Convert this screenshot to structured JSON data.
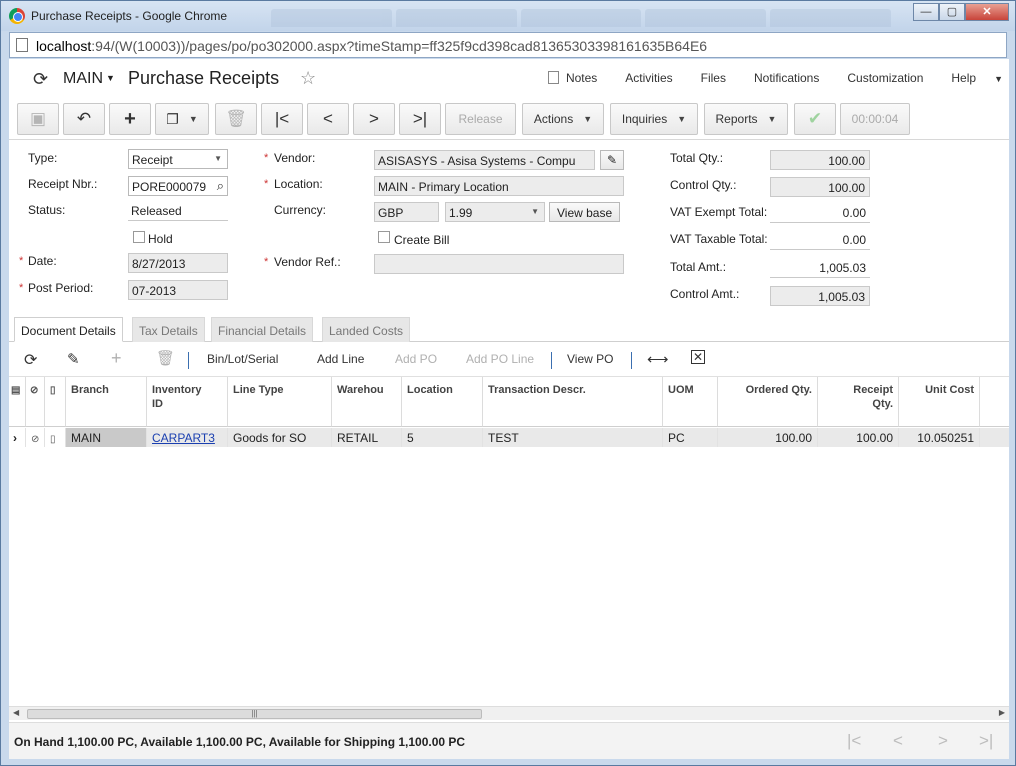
{
  "window": {
    "title": "Purchase Receipts - Google Chrome",
    "minimize": "—",
    "maximize": "▢",
    "close": "✕",
    "url_host": "localhost",
    "url_rest": ":94/(W(10003))/pages/po/po302000.aspx?timeStamp=ff325f9cd398cad81365303398161635B64E6"
  },
  "header": {
    "company": "MAIN",
    "title": "Purchase Receipts",
    "links": [
      "Notes",
      "Activities",
      "Files",
      "Notifications",
      "Customization",
      "Help"
    ]
  },
  "toolbar": {
    "release": "Release",
    "actions": "Actions",
    "inquiries": "Inquiries",
    "reports": "Reports",
    "timer": "00:00:04"
  },
  "form": {
    "type_label": "Type:",
    "type_value": "Receipt",
    "receipt_nbr_label": "Receipt Nbr.:",
    "receipt_nbr_value": "PORE000079",
    "status_label": "Status:",
    "status_value": "Released",
    "hold_label": "Hold",
    "date_label": "Date:",
    "date_value": "8/27/2013",
    "post_period_label": "Post Period:",
    "post_period_value": "07-2013",
    "vendor_label": "Vendor:",
    "vendor_value": "ASISASYS - Asisa Systems - Compu",
    "location_label": "Location:",
    "location_value": "MAIN - Primary Location",
    "currency_label": "Currency:",
    "currency_code": "GBP",
    "currency_rate": "1.99",
    "view_base": "View base",
    "create_bill_label": "Create Bill",
    "vendor_ref_label": "Vendor Ref.:",
    "vendor_ref_value": "",
    "total_qty_label": "Total Qty.:",
    "total_qty_value": "100.00",
    "control_qty_label": "Control Qty.:",
    "control_qty_value": "100.00",
    "vat_exempt_label": "VAT Exempt Total:",
    "vat_exempt_value": "0.00",
    "vat_taxable_label": "VAT Taxable Total:",
    "vat_taxable_value": "0.00",
    "total_amt_label": "Total Amt.:",
    "total_amt_value": "1,005.03",
    "control_amt_label": "Control Amt.:",
    "control_amt_value": "1,005.03"
  },
  "tabs": [
    "Document Details",
    "Tax Details",
    "Financial Details",
    "Landed Costs"
  ],
  "grid_toolbar": {
    "bin_lot_serial": "Bin/Lot/Serial",
    "add_line": "Add Line",
    "add_po": "Add PO",
    "add_po_line": "Add PO Line",
    "view_po": "View PO"
  },
  "grid": {
    "columns": {
      "branch": "Branch",
      "inventory_id_1": "Inventory",
      "inventory_id_2": "ID",
      "line_type": "Line Type",
      "warehouse": "Warehou",
      "location": "Location",
      "transaction_descr": "Transaction Descr.",
      "uom": "UOM",
      "ordered_qty": "Ordered Qty.",
      "receipt_qty_1": "Receipt",
      "receipt_qty_2": "Qty.",
      "unit_cost": "Unit Cost"
    },
    "row": {
      "branch": "MAIN",
      "inventory_id": "CARPART3",
      "line_type": "Goods for SO",
      "warehouse": "RETAIL",
      "location": "5",
      "transaction_descr": "TEST",
      "uom": "PC",
      "ordered_qty": "100.00",
      "receipt_qty": "100.00",
      "unit_cost": "10.050251"
    }
  },
  "status": {
    "text": "On Hand 1,100.00 PC, Available 1,100.00 PC, Available for Shipping 1,100.00 PC"
  },
  "icons": [
    "chrome-logo-icon",
    "page-icon",
    "refresh-icon",
    "star-icon",
    "save-icon",
    "undo-icon",
    "plus-icon",
    "copy-paste-icon",
    "delete-icon",
    "first-icon",
    "prev-icon",
    "next-icon",
    "last-icon",
    "check-icon",
    "search-icon",
    "pencil-icon",
    "fit-columns-icon",
    "excel-export-icon",
    "paperclip-icon",
    "note-icon",
    "row-selector-icon"
  ]
}
